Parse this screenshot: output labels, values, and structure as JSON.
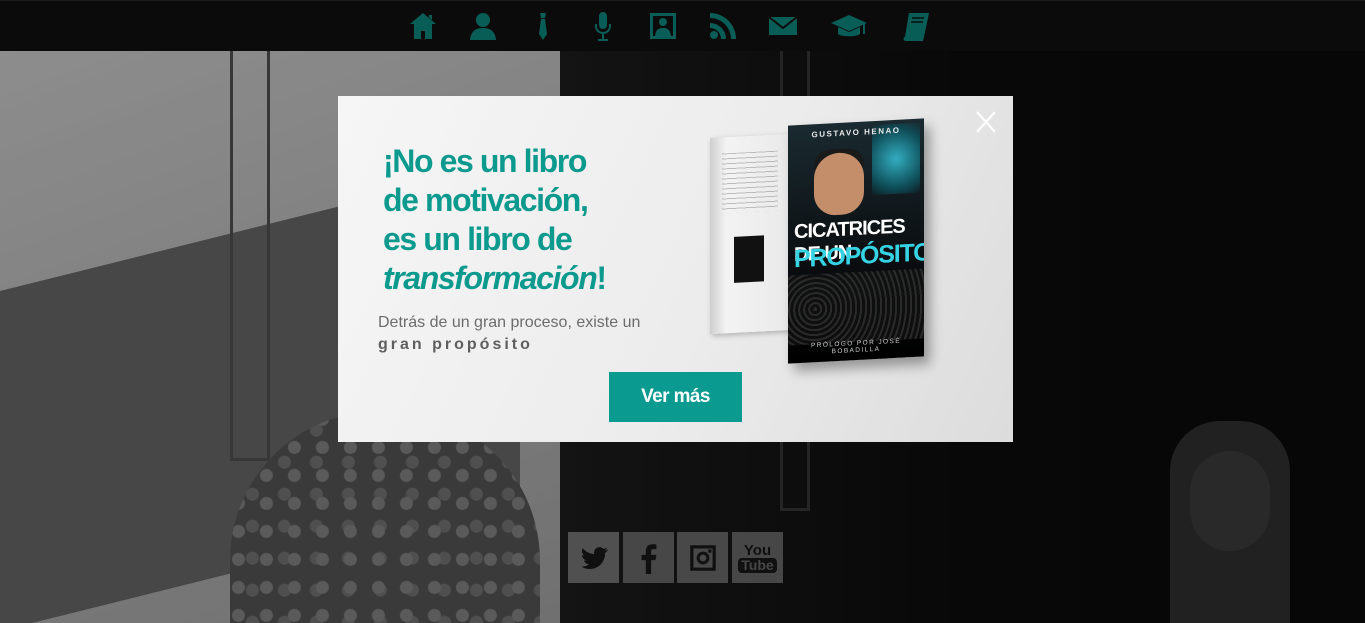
{
  "nav": {
    "icons": [
      "home-icon",
      "user-icon",
      "tie-icon",
      "microphone-icon",
      "portrait-icon",
      "rss-icon",
      "envelope-icon",
      "graduation-cap-icon",
      "book-icon"
    ],
    "accent": "#0d8f84"
  },
  "social": {
    "twitter": "twitter-icon",
    "facebook": "facebook-icon",
    "instagram": "instagram-icon",
    "youtube": "youtube-icon",
    "youtube_text_top": "You",
    "youtube_text_bottom": "Tube"
  },
  "modal": {
    "headline_line1": "¡No es un libro",
    "headline_line2": "de motivación,",
    "headline_line3": "es un libro de",
    "headline_emphasis": "transformación",
    "headline_end": "!",
    "subtitle_line1": "Detrás de un gran proceso, existe un",
    "subtitle_line2": "gran propósito",
    "button_label": "Ver más",
    "close_icon": "close-icon",
    "accent": "#0b9a8f"
  },
  "book": {
    "author": "GUSTAVO HENAO",
    "title_line1": "CICATRICES DE UN",
    "title_line2": "PROPÓSITO",
    "footer": "PRÓLOGO POR JOSÉ BOBADILLA"
  }
}
